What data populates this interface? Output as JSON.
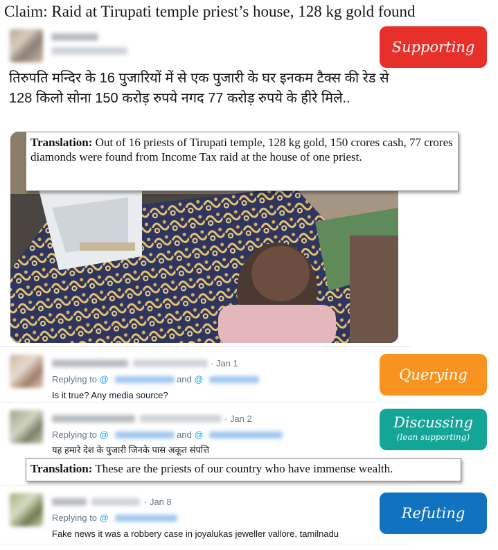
{
  "claim": "Claim: Raid at Tirupati temple priest’s house, 128 kg gold found",
  "main_tweet": {
    "text": "तिरुपति मन्दिर के 16 पुजारियों में से एक पुजारी के घर इनकम टैक्स की रेड से 128 किलो सोना 150 करोड़ रुपये नगद 77 करोड़ रुपये के हीरे मिले..",
    "translation_label": "Translation:",
    "translation_text": " Out of 16 priests of Tirupati temple, 128 kg gold, 150 crores cash, 77 crores diamonds were found from Income Tax raid at the house of one priest.",
    "badge": "Supporting",
    "badge_color": "#e8302a"
  },
  "replies": [
    {
      "date": "· Jan 1",
      "replying": "Replying to ",
      "at1": "@",
      "and": " and ",
      "at2": "@",
      "text": "Is it true? Any media source?",
      "badge": "Querying",
      "badge_color": "#f7931e"
    },
    {
      "date": "· Jan 2",
      "replying": "Replying to ",
      "at1": "@",
      "and": " and ",
      "at2": "@",
      "text": "यह हमारे देश के पुजारी जिनके पास अकूत संपत्ति",
      "translation_label": "Translation:",
      "translation_text": " These are the priests of our country who have immense wealth.",
      "badge": "Discussing",
      "badge_sub": "(lean supporting)",
      "badge_color": "#13a596"
    },
    {
      "date": "· Jan 8",
      "replying": "Replying to ",
      "at1": "@",
      "text": "Fake news it was a robbery case in joyalukas jeweller vallore, tamilnadu",
      "badge": "Refuting",
      "badge_color": "#1172bf"
    }
  ]
}
